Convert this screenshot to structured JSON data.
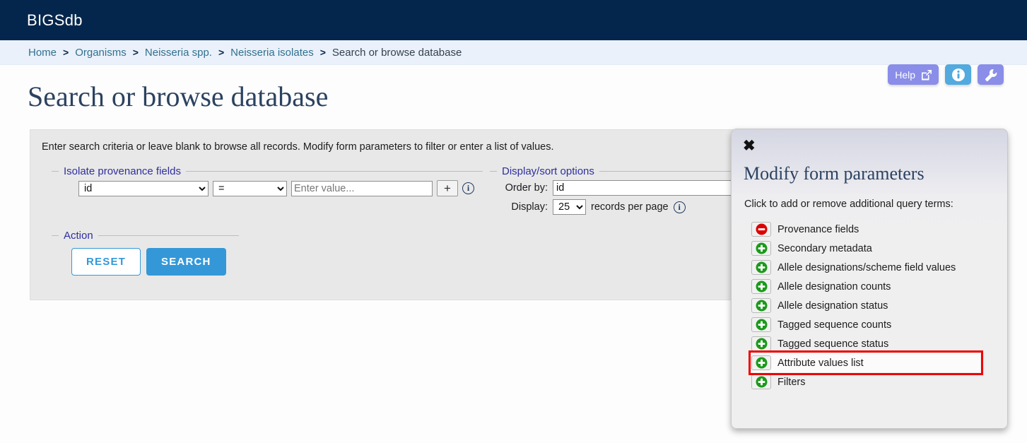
{
  "topbar": {
    "brand": "BIGSdb",
    "bg": "#05264c"
  },
  "breadcrumb": {
    "items": [
      {
        "label": "Home",
        "link": true
      },
      {
        "label": "Organisms",
        "link": true
      },
      {
        "label": "Neisseria spp.",
        "link": true
      },
      {
        "label": "Neisseria isolates",
        "link": true
      },
      {
        "label": "Search or browse database",
        "link": false
      }
    ],
    "separator": ">"
  },
  "header_buttons": {
    "help_label": "Help",
    "help_icon": "external-link-icon",
    "info_icon": "info-icon",
    "wrench_icon": "wrench-icon",
    "purple": "#8a8ee8",
    "blue": "#52aade"
  },
  "page": {
    "title": "Search or browse database"
  },
  "form": {
    "intro": "Enter search criteria or leave blank to browse all records. Modify form parameters to filter or enter a list of values.",
    "provenance": {
      "legend": "Isolate provenance fields",
      "field_value": "id",
      "operator_value": "=",
      "value_placeholder": "Enter value...",
      "value_current": "",
      "add_label": "+",
      "info_glyph": "i"
    },
    "display": {
      "legend": "Display/sort options",
      "order_by_label": "Order by:",
      "order_by_value": "id",
      "display_label": "Display:",
      "records_value": "25",
      "records_suffix": "records per page",
      "info_glyph": "i"
    },
    "action": {
      "legend": "Action",
      "reset_label": "RESET",
      "search_label": "SEARCH",
      "search_bg": "#3498d8"
    }
  },
  "modal": {
    "close_glyph": "✖",
    "title": "Modify form parameters",
    "subtitle": "Click to add or remove additional query terms:",
    "highlight_color": "#ee0000",
    "items": [
      {
        "label": "Provenance fields",
        "icon": "minus-circle-icon",
        "state": "remove",
        "highlighted": false
      },
      {
        "label": "Secondary metadata",
        "icon": "plus-circle-icon",
        "state": "add",
        "highlighted": false
      },
      {
        "label": "Allele designations/scheme field values",
        "icon": "plus-circle-icon",
        "state": "add",
        "highlighted": false
      },
      {
        "label": "Allele designation counts",
        "icon": "plus-circle-icon",
        "state": "add",
        "highlighted": false
      },
      {
        "label": "Allele designation status",
        "icon": "plus-circle-icon",
        "state": "add",
        "highlighted": false
      },
      {
        "label": "Tagged sequence counts",
        "icon": "plus-circle-icon",
        "state": "add",
        "highlighted": false
      },
      {
        "label": "Tagged sequence status",
        "icon": "plus-circle-icon",
        "state": "add",
        "highlighted": false
      },
      {
        "label": "Attribute values list",
        "icon": "plus-circle-icon",
        "state": "add",
        "highlighted": true
      },
      {
        "label": "Filters",
        "icon": "plus-circle-icon",
        "state": "add",
        "highlighted": false
      }
    ]
  }
}
